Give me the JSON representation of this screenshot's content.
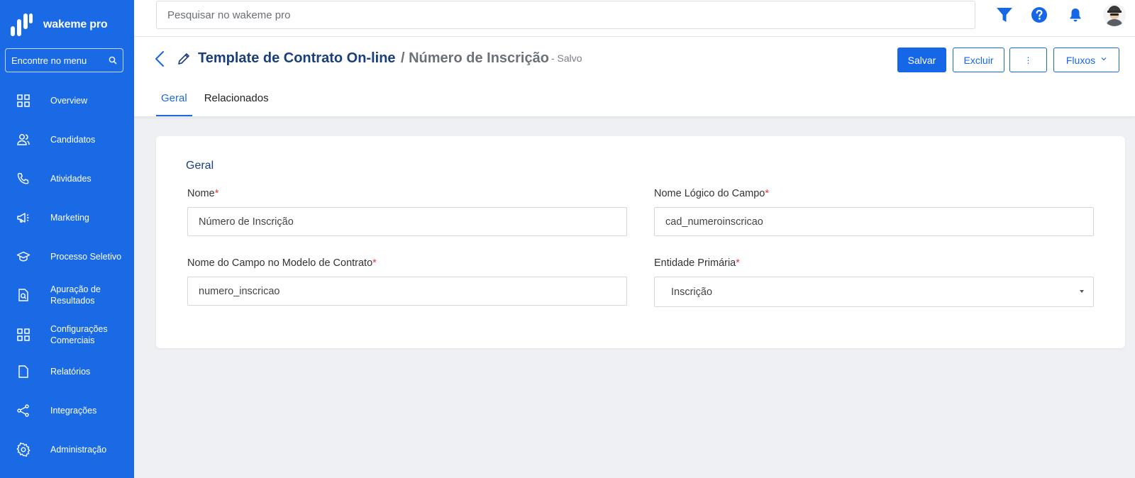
{
  "app": {
    "brand": "wakeme pro"
  },
  "sidebar": {
    "search_placeholder": "Encontre no menu",
    "items": [
      {
        "label": "Overview",
        "icon": "grid-icon"
      },
      {
        "label": "Candidatos",
        "icon": "users-icon"
      },
      {
        "label": "Atividades",
        "icon": "phone-icon"
      },
      {
        "label": "Marketing",
        "icon": "megaphone-icon"
      },
      {
        "label": "Processo Seletivo",
        "icon": "graduation-cap-icon"
      },
      {
        "label": "Apuração de Resultados",
        "icon": "document-search-icon"
      },
      {
        "label": "Configurações Comerciais",
        "icon": "grid-icon"
      },
      {
        "label": "Relatórios",
        "icon": "report-icon"
      },
      {
        "label": "Integrações",
        "icon": "share-icon"
      },
      {
        "label": "Administração",
        "icon": "gear-icon"
      }
    ]
  },
  "topbar": {
    "search_placeholder": "Pesquisar no wakeme pro",
    "icons": [
      "filter-icon",
      "help-icon",
      "bell-icon",
      "avatar"
    ]
  },
  "header": {
    "title": "Template de Contrato On-line",
    "subtitle": "/ Número de Inscrição",
    "status": "- Salvo",
    "buttons": {
      "save": "Salvar",
      "delete": "Excluir",
      "more": "⋮",
      "flows": "Fluxos"
    },
    "tabs": [
      {
        "label": "Geral",
        "active": true
      },
      {
        "label": "Relacionados",
        "active": false
      }
    ]
  },
  "form": {
    "section_title": "Geral",
    "fields": {
      "nome": {
        "label": "Nome",
        "required": "*",
        "value": "Número de Inscrição"
      },
      "nome_logico": {
        "label": "Nome Lógico do Campo",
        "required": "*",
        "value": "cad_numeroinscricao"
      },
      "nome_modelo": {
        "label": "Nome do Campo no Modelo de Contrato",
        "required": "*",
        "value": "numero_inscricao"
      },
      "entidade": {
        "label": "Entidade Primária",
        "required": "*",
        "value": "Inscrição"
      }
    }
  },
  "colors": {
    "sidebar": "#1a6ae6",
    "primary": "#1666e8",
    "title": "#1a3f7a",
    "required": "#e53935"
  }
}
